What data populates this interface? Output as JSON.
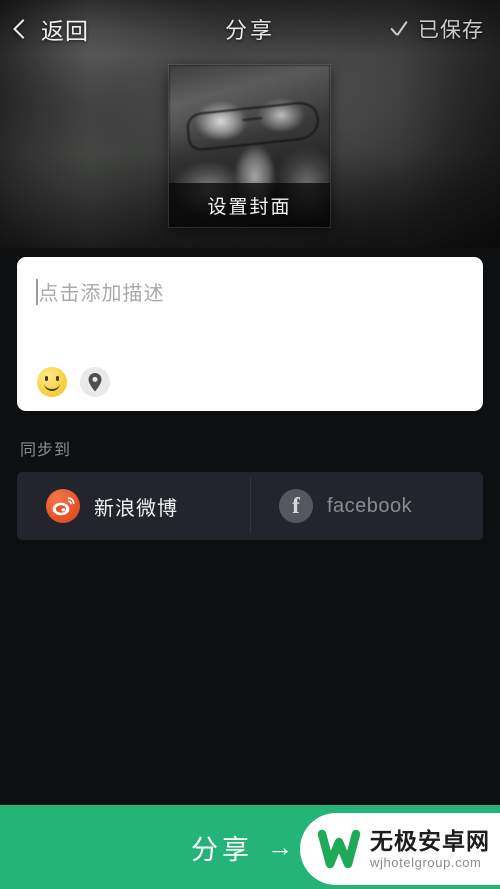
{
  "app": {
    "accent_green": "#25b478",
    "background": "#0d0f10",
    "card_background": "#ffffff",
    "panel_background": "#23252c"
  },
  "topbar": {
    "back_icon": "chevron-left-icon",
    "back_label": "返回",
    "title": "分享",
    "saved_icon": "check-icon",
    "saved_label": "已保存"
  },
  "cover": {
    "caption": "设置封面",
    "image_alt": "grayscale portrait with glasses"
  },
  "description": {
    "placeholder": "点击添加描述",
    "value": "",
    "tools": [
      {
        "name": "emoji-icon",
        "label": "emoji"
      },
      {
        "name": "location-pin-icon",
        "label": "location"
      }
    ]
  },
  "sync": {
    "label": "同步到",
    "items": [
      {
        "name": "新浪微博",
        "icon": "weibo-icon",
        "active": true,
        "icon_color": "#e8542a"
      },
      {
        "name": "facebook",
        "icon": "facebook-icon",
        "active": false,
        "icon_color": "#55565e"
      }
    ]
  },
  "share_bar": {
    "label": "分享",
    "arrow": "→"
  },
  "watermark": {
    "logo": "w-logo-icon",
    "title": "无极安卓网",
    "url": "wjhotelgroup.com",
    "logo_color": "#1faa5a"
  }
}
